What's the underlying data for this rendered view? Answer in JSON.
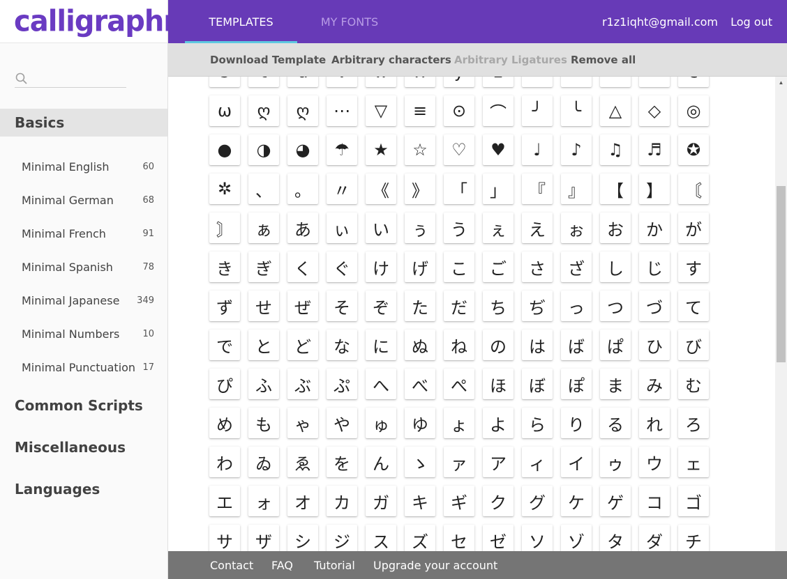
{
  "app": {
    "logo_text": "calligraphr",
    "brand_color": "#673ab7",
    "accent_color": "#5ec8e0"
  },
  "header": {
    "tabs": [
      {
        "label": "TEMPLATES",
        "active": true
      },
      {
        "label": "MY FONTS",
        "active": false
      }
    ],
    "user_email": "r1z1iqht@gmail.com",
    "logout_label": "Log out"
  },
  "toolbar": {
    "actions": [
      {
        "label": "Download Template",
        "enabled": true
      },
      {
        "label": "Arbitrary characters",
        "enabled": true
      },
      {
        "label": "Arbitrary Ligatures",
        "enabled": false
      },
      {
        "label": "Remove all",
        "enabled": true
      }
    ]
  },
  "sidebar": {
    "search": {
      "placeholder": "",
      "value": "",
      "icon": "search-icon"
    },
    "sections": [
      {
        "label": "Basics",
        "active": true
      },
      {
        "label": "Common Scripts",
        "active": false
      },
      {
        "label": "Miscellaneous",
        "active": false
      },
      {
        "label": "Languages",
        "active": false
      }
    ],
    "items": [
      {
        "label": "Minimal English",
        "count": "60"
      },
      {
        "label": "Minimal German",
        "count": "68"
      },
      {
        "label": "Minimal French",
        "count": "91"
      },
      {
        "label": "Minimal Spanish",
        "count": "78"
      },
      {
        "label": "Minimal Japanese",
        "count": "349"
      },
      {
        "label": "Minimal Numbers",
        "count": "10"
      },
      {
        "label": "Minimal Punctuation",
        "count": "17"
      }
    ]
  },
  "template": {
    "characters": [
      "s",
      "t",
      "u",
      "v",
      "w",
      "x",
      "y",
      "z",
      "«",
      "¬",
      "°",
      "»",
      "ε",
      "ω",
      "ღ",
      "ღ",
      "⋯",
      "▽",
      "≡",
      "⊙",
      "⌒",
      "╯",
      "╰",
      "△",
      "◇",
      "◎",
      "●",
      "◑",
      "◕",
      "☂",
      "★",
      "☆",
      "♡",
      "♥",
      "♩",
      "♪",
      "♫",
      "♬",
      "✪",
      "✲",
      "、",
      "。",
      "〃",
      "《",
      "》",
      "「",
      "」",
      "『",
      "』",
      "【",
      "】",
      "〘",
      "〙",
      "ぁ",
      "あ",
      "ぃ",
      "い",
      "ぅ",
      "う",
      "ぇ",
      "え",
      "ぉ",
      "お",
      "か",
      "が",
      "き",
      "ぎ",
      "く",
      "ぐ",
      "け",
      "げ",
      "こ",
      "ご",
      "さ",
      "ざ",
      "し",
      "じ",
      "す",
      "ず",
      "せ",
      "ぜ",
      "そ",
      "ぞ",
      "た",
      "だ",
      "ち",
      "ぢ",
      "っ",
      "つ",
      "づ",
      "て",
      "で",
      "と",
      "ど",
      "な",
      "に",
      "ぬ",
      "ね",
      "の",
      "は",
      "ば",
      "ぱ",
      "ひ",
      "び",
      "ぴ",
      "ふ",
      "ぶ",
      "ぷ",
      "へ",
      "べ",
      "ぺ",
      "ほ",
      "ぼ",
      "ぽ",
      "ま",
      "み",
      "む",
      "め",
      "も",
      "ゃ",
      "や",
      "ゅ",
      "ゆ",
      "ょ",
      "よ",
      "ら",
      "り",
      "る",
      "れ",
      "ろ",
      "わ",
      "ゐ",
      "ゑ",
      "を",
      "ん",
      "ゝ",
      "ァ",
      "ア",
      "ィ",
      "イ",
      "ゥ",
      "ウ",
      "ェ",
      "エ",
      "ォ",
      "オ",
      "カ",
      "ガ",
      "キ",
      "ギ",
      "ク",
      "グ",
      "ケ",
      "ゲ",
      "コ",
      "ゴ",
      "サ",
      "ザ",
      "シ",
      "ジ",
      "ス",
      "ズ",
      "セ",
      "ゼ",
      "ソ",
      "ゾ",
      "タ",
      "ダ",
      "チ"
    ]
  },
  "footer": {
    "links": [
      "Contact",
      "FAQ",
      "Tutorial",
      "Upgrade your account"
    ]
  }
}
